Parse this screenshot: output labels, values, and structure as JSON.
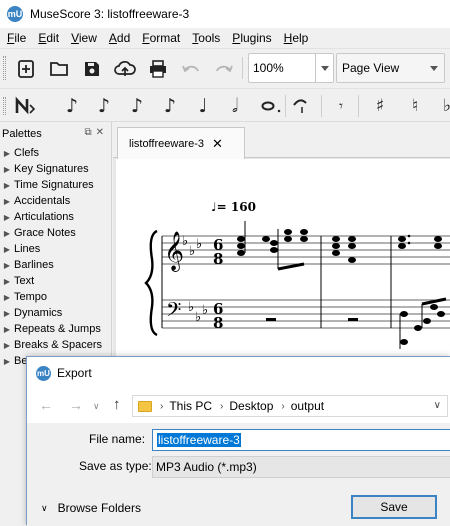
{
  "app": {
    "title": "MuseScore 3: listoffreeware-3",
    "logo_text": "mU"
  },
  "menu": [
    {
      "ul": "F",
      "rest": "ile"
    },
    {
      "ul": "E",
      "rest": "dit"
    },
    {
      "ul": "V",
      "rest": "iew"
    },
    {
      "ul": "A",
      "rest": "dd"
    },
    {
      "ul": "F",
      "rest": "ormat",
      "pre": ""
    },
    {
      "ul": "T",
      "rest": "ools"
    },
    {
      "ul": "P",
      "rest": "lugins"
    },
    {
      "ul": "H",
      "rest": "elp"
    }
  ],
  "toolbar": {
    "zoom": "100%",
    "view_mode": "Page View",
    "icons": [
      "new-score-icon",
      "open-icon",
      "save-icon",
      "cloud-upload-icon",
      "print-icon",
      "undo-icon",
      "redo-icon"
    ]
  },
  "note_input": {
    "icons": [
      "note-input-mode-icon",
      "64th-note-icon",
      "32nd-note-icon",
      "16th-note-icon",
      "eighth-note-icon",
      "quarter-note-icon",
      "half-note-icon",
      "whole-note-icon",
      "augmentation-dot-icon",
      "tie-icon",
      "rest-icon",
      "sharp-icon",
      "natural-icon",
      "flat-icon"
    ]
  },
  "palettes": {
    "title": "Palettes",
    "header_icons": "ᴀ ✕",
    "items": [
      "Clefs",
      "Key Signatures",
      "Time Signatures",
      "Accidentals",
      "Articulations",
      "Grace Notes",
      "Lines",
      "Barlines",
      "Text",
      "Tempo",
      "Dynamics",
      "Repeats & Jumps",
      "Breaks & Spacers",
      "Be"
    ]
  },
  "document": {
    "tab_label": "listoffreeware-3",
    "tempo_mark": "♩= 160",
    "time_signature_top": "6",
    "time_signature_bottom": "8"
  },
  "export_dialog": {
    "title": "Export",
    "breadcrumb": [
      "This PC",
      "Desktop",
      "output"
    ],
    "file_name_label": "File name:",
    "file_name_value": "listoffreeware-3",
    "save_type_label": "Save as type:",
    "save_type_value": "MP3 Audio (*.mp3)",
    "browse_label": "Browse Folders",
    "save_label": "Save"
  },
  "colors": {
    "accent": "#3a84c4",
    "selection": "#0078d7",
    "folder": "#f4c542"
  }
}
